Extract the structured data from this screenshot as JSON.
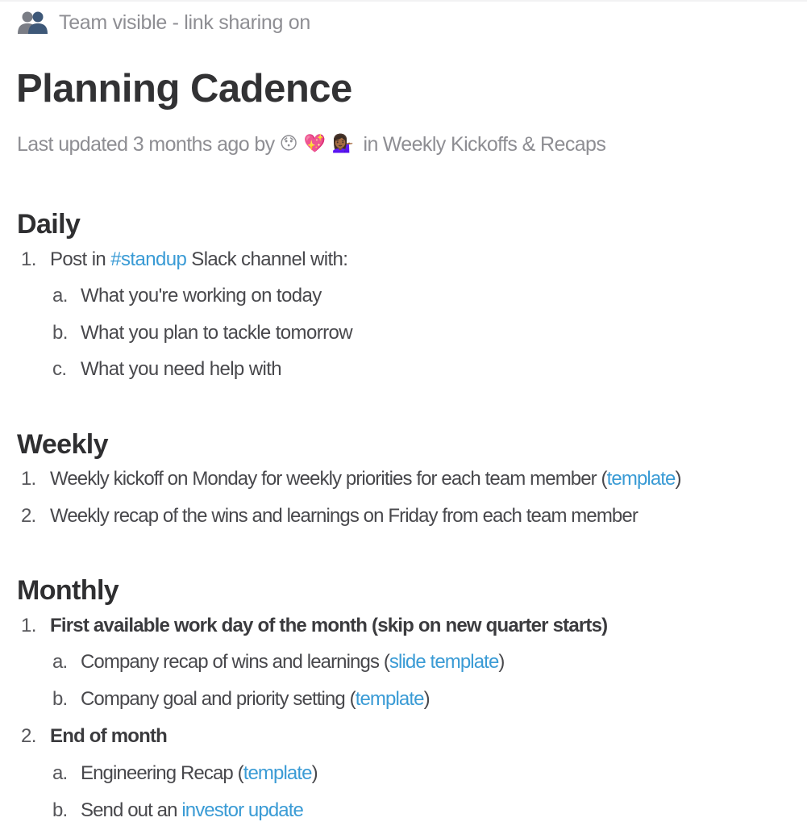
{
  "visibility": {
    "icon": "people-icon",
    "label": "Team visible - link sharing on"
  },
  "page": {
    "title": "Planning Cadence"
  },
  "meta": {
    "prefix": "Last updated 3 months ago by",
    "avatars": [
      {
        "name": "hushed-face-emoji",
        "glyph": "😯"
      },
      {
        "name": "sparkling-heart-emoji",
        "glyph": "💖"
      },
      {
        "name": "tipping-hand-woman-emoji",
        "glyph": "💁🏾‍♀️"
      }
    ],
    "in_label": "in",
    "collection": "Weekly Kickoffs & Recaps"
  },
  "colors": {
    "link": "#3a9bd5",
    "heading": "#2f2f31",
    "body_text": "#48484c",
    "muted_text": "#8e8e93"
  },
  "sections": {
    "daily": {
      "heading": "Daily",
      "items": [
        {
          "marker": "1.",
          "before": "Post in",
          "link": "#standup",
          "after": "Slack channel with:",
          "subitems": [
            {
              "marker": "a.",
              "text": "What you're working on today"
            },
            {
              "marker": "b.",
              "text": "What you plan to tackle tomorrow"
            },
            {
              "marker": "c.",
              "text": "What you need help with"
            }
          ]
        }
      ]
    },
    "weekly": {
      "heading": "Weekly",
      "items": [
        {
          "marker": "1.",
          "text": "Weekly kickoff on Monday for weekly priorities for each team member (",
          "link": "template",
          "after": ")"
        },
        {
          "marker": "2.",
          "text": "Weekly recap of the wins and learnings on Friday from each team member"
        }
      ]
    },
    "monthly": {
      "heading": "Monthly",
      "items": [
        {
          "marker": "1.",
          "text": "First available work day of the month (skip on new quarter starts)",
          "subitems": [
            {
              "marker": "a.",
              "text": "Company recap of wins and learnings (",
              "link": "slide template",
              "after": ")"
            },
            {
              "marker": "b.",
              "text": "Company goal and priority setting (",
              "link": "template",
              "after": ")"
            }
          ]
        },
        {
          "marker": "2.",
          "text": "End of month",
          "subitems": [
            {
              "marker": "a.",
              "text": "Engineering Recap (",
              "link": "template",
              "after": ")"
            },
            {
              "marker": "b.",
              "text": "Send out an ",
              "link": "investor update",
              "after": ""
            }
          ]
        }
      ]
    }
  }
}
